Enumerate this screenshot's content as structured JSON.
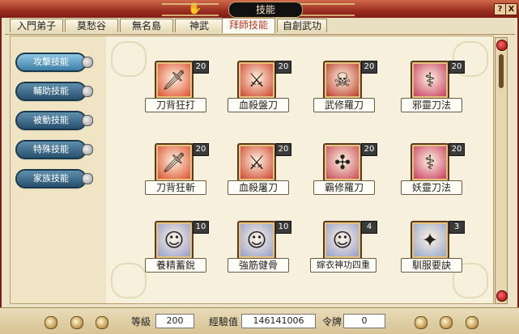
{
  "window": {
    "title": "技能",
    "help_label": "?",
    "close_label": "X"
  },
  "tabs": [
    "入門弟子",
    "莫愁谷",
    "無名島",
    "神武",
    "拜師技能",
    "自創武功"
  ],
  "active_tab": "拜師技能",
  "categories": [
    "攻擊技能",
    "輔助技能",
    "被動技能",
    "特殊技能",
    "家族技能"
  ],
  "active_category": "攻擊技能",
  "skills": [
    {
      "name": "刀背狂打",
      "level": "20",
      "icon": "blade-fist-icon",
      "color": "#d8411f"
    },
    {
      "name": "血殺盤刀",
      "level": "20",
      "icon": "blood-blade-icon",
      "color": "#c9331c"
    },
    {
      "name": "武修羅刀",
      "level": "20",
      "icon": "asura-mask-icon",
      "color": "#b52a1a"
    },
    {
      "name": "邪靈刀法",
      "level": "20",
      "icon": "evil-spirit-icon",
      "color": "#c02a55"
    },
    {
      "name": "刀背狂斬",
      "level": "20",
      "icon": "blade-slash-icon",
      "color": "#d8411f"
    },
    {
      "name": "血殺屠刀",
      "level": "20",
      "icon": "slaughter-blade-icon",
      "color": "#c9331c"
    },
    {
      "name": "霸修羅刀",
      "level": "20",
      "icon": "tyrant-asura-icon",
      "color": "#c03a4a"
    },
    {
      "name": "妖靈刀法",
      "level": "20",
      "icon": "demon-spirit-icon",
      "color": "#c02a55"
    },
    {
      "name": "養精蓄銳",
      "level": "10",
      "icon": "rest-up-icon",
      "color": "#8a96c9"
    },
    {
      "name": "強筋健骨",
      "level": "10",
      "icon": "strong-muscle-icon",
      "color": "#8a96c9"
    },
    {
      "name": "嫁衣神功四重",
      "level": "4",
      "icon": "wedding-gown-icon",
      "color": "#8a96c9"
    },
    {
      "name": "馴服要訣",
      "level": "3",
      "icon": "taming-icon",
      "color": "#8aa0c9"
    }
  ],
  "status": {
    "level_label": "等級",
    "level_value": "200",
    "exp_label": "經驗值",
    "exp_value": "146141006",
    "token_label": "令牌",
    "token_value": "0"
  }
}
